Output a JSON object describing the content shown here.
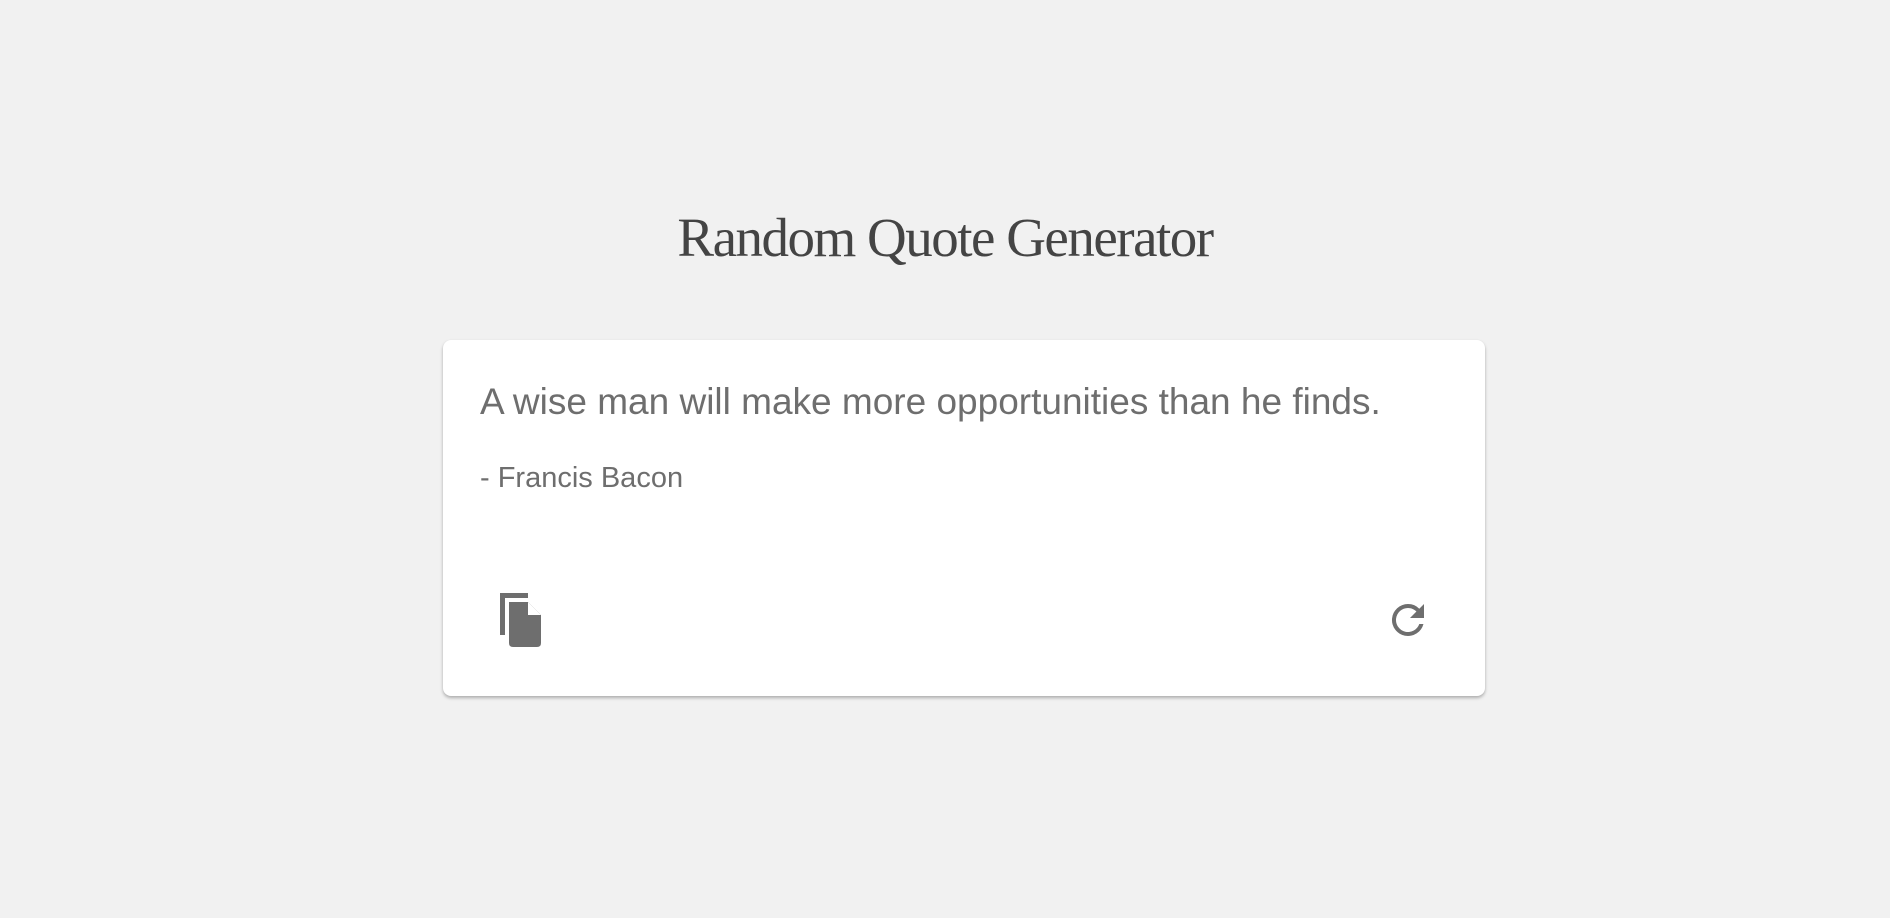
{
  "header": {
    "title": "Random Quote Generator"
  },
  "quote": {
    "text": "A wise man will make more opportunities than he finds.",
    "author": "- Francis Bacon"
  },
  "actions": {
    "copy_icon": "copy-icon",
    "refresh_icon": "refresh-icon"
  },
  "colors": {
    "background": "#f1f1f1",
    "card": "#ffffff",
    "title_text": "#444444",
    "body_text": "#6e6e6e",
    "icon": "#6e6e6e"
  }
}
